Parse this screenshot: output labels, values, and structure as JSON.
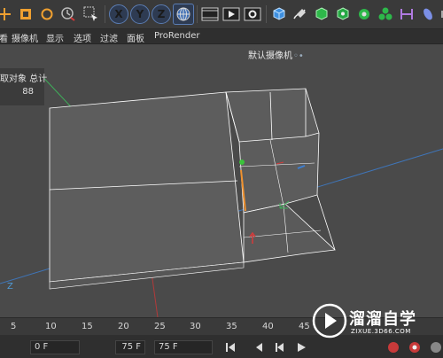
{
  "toolbar": {
    "axis_x": "X",
    "axis_y": "Y",
    "axis_z": "Z"
  },
  "menu": {
    "items": [
      "看",
      "摄像机",
      "显示",
      "选项",
      "过滤",
      "面板",
      "ProRender"
    ]
  },
  "viewport": {
    "camera_label": "默认摄像机",
    "camera_icon": "◦•",
    "stats_title": "取对象 总计",
    "stats_value": "88",
    "axis_label": "Z"
  },
  "timeline": {
    "ticks": [
      "5",
      "10",
      "15",
      "20",
      "25",
      "30",
      "35",
      "40",
      "45"
    ],
    "current_frame": "0 F",
    "end_frame": "75 F",
    "end_frame_2": "75 F"
  },
  "watermark": {
    "title": "溜溜自学",
    "url": "ZIXUE.3D66.COM"
  },
  "colors": {
    "accent_blue": "#3f7fd6",
    "axis_x_red": "#d43b3b",
    "axis_y_green": "#3bc43b",
    "axis_z_blue": "#3b7fd4",
    "selection_orange": "#f0922f"
  }
}
